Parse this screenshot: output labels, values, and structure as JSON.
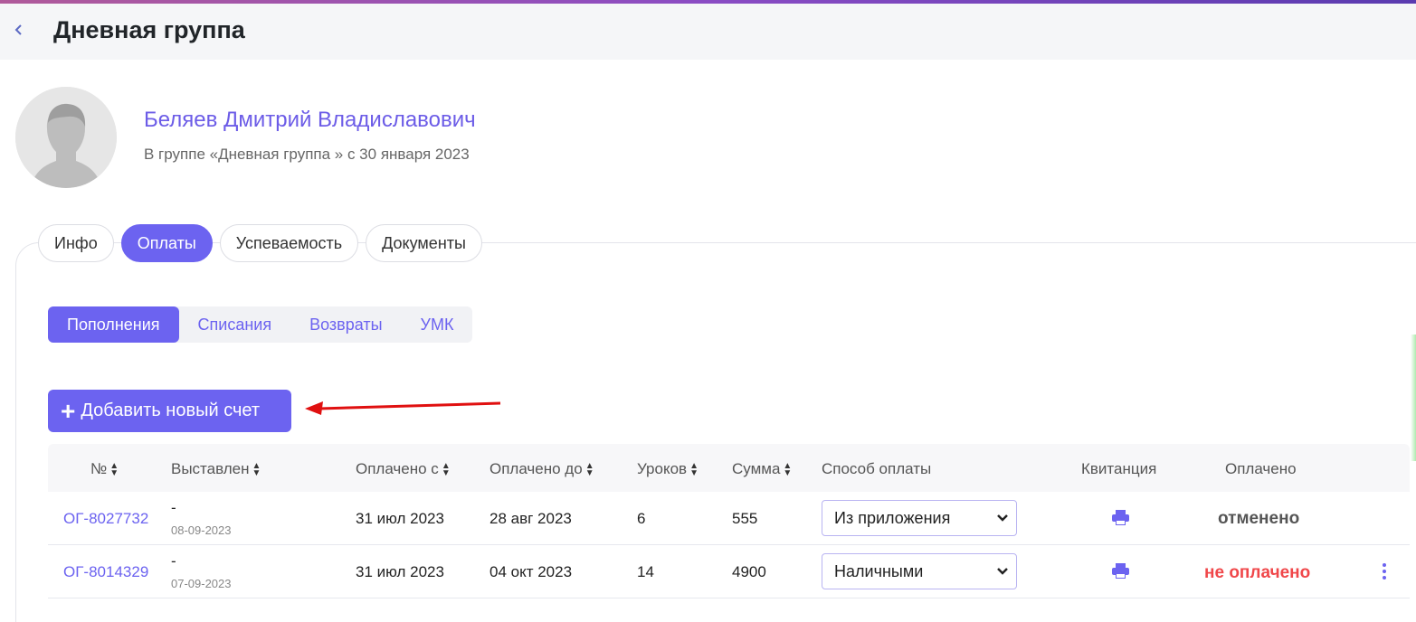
{
  "header": {
    "title": "Дневная группа",
    "back_icon": "chevron-left-icon"
  },
  "student": {
    "name": "Беляев Дмитрий Владиславович",
    "subtitle": "В группе «Дневная группа » с 30 января 2023"
  },
  "tabs": [
    {
      "label": "Инфо",
      "active": false
    },
    {
      "label": "Оплаты",
      "active": true
    },
    {
      "label": "Успеваемость",
      "active": false
    },
    {
      "label": "Документы",
      "active": false
    }
  ],
  "subtabs": [
    {
      "label": "Пополнения",
      "active": true
    },
    {
      "label": "Списания",
      "active": false
    },
    {
      "label": "Возвраты",
      "active": false
    },
    {
      "label": "УМК",
      "active": false
    }
  ],
  "add_button": {
    "label": "Добавить новый счет"
  },
  "table": {
    "headers": {
      "number": "№",
      "issued": "Выставлен",
      "paid_from": "Оплачено с",
      "paid_to": "Оплачено до",
      "lessons": "Уроков",
      "sum": "Сумма",
      "method": "Способ оплаты",
      "receipt": "Квитанция",
      "paid": "Оплачено"
    },
    "rows": [
      {
        "number": "ОГ-8027732",
        "issued": "-",
        "issued_date": "08-09-2023",
        "paid_from": "31 июл 2023",
        "paid_to": "28 авг 2023",
        "lessons": "6",
        "sum": "555",
        "method": "Из приложения",
        "status": "отменено",
        "status_color": "#555555"
      },
      {
        "number": "ОГ-8014329",
        "issued": "-",
        "issued_date": "07-09-2023",
        "paid_from": "31 июл 2023",
        "paid_to": "04 окт 2023",
        "lessons": "14",
        "sum": "4900",
        "method": "Наличными",
        "status": "не оплачено",
        "status_color": "#f0474a"
      }
    ]
  },
  "colors": {
    "accent": "#6c63f0",
    "annotation_arrow": "#e01010"
  }
}
